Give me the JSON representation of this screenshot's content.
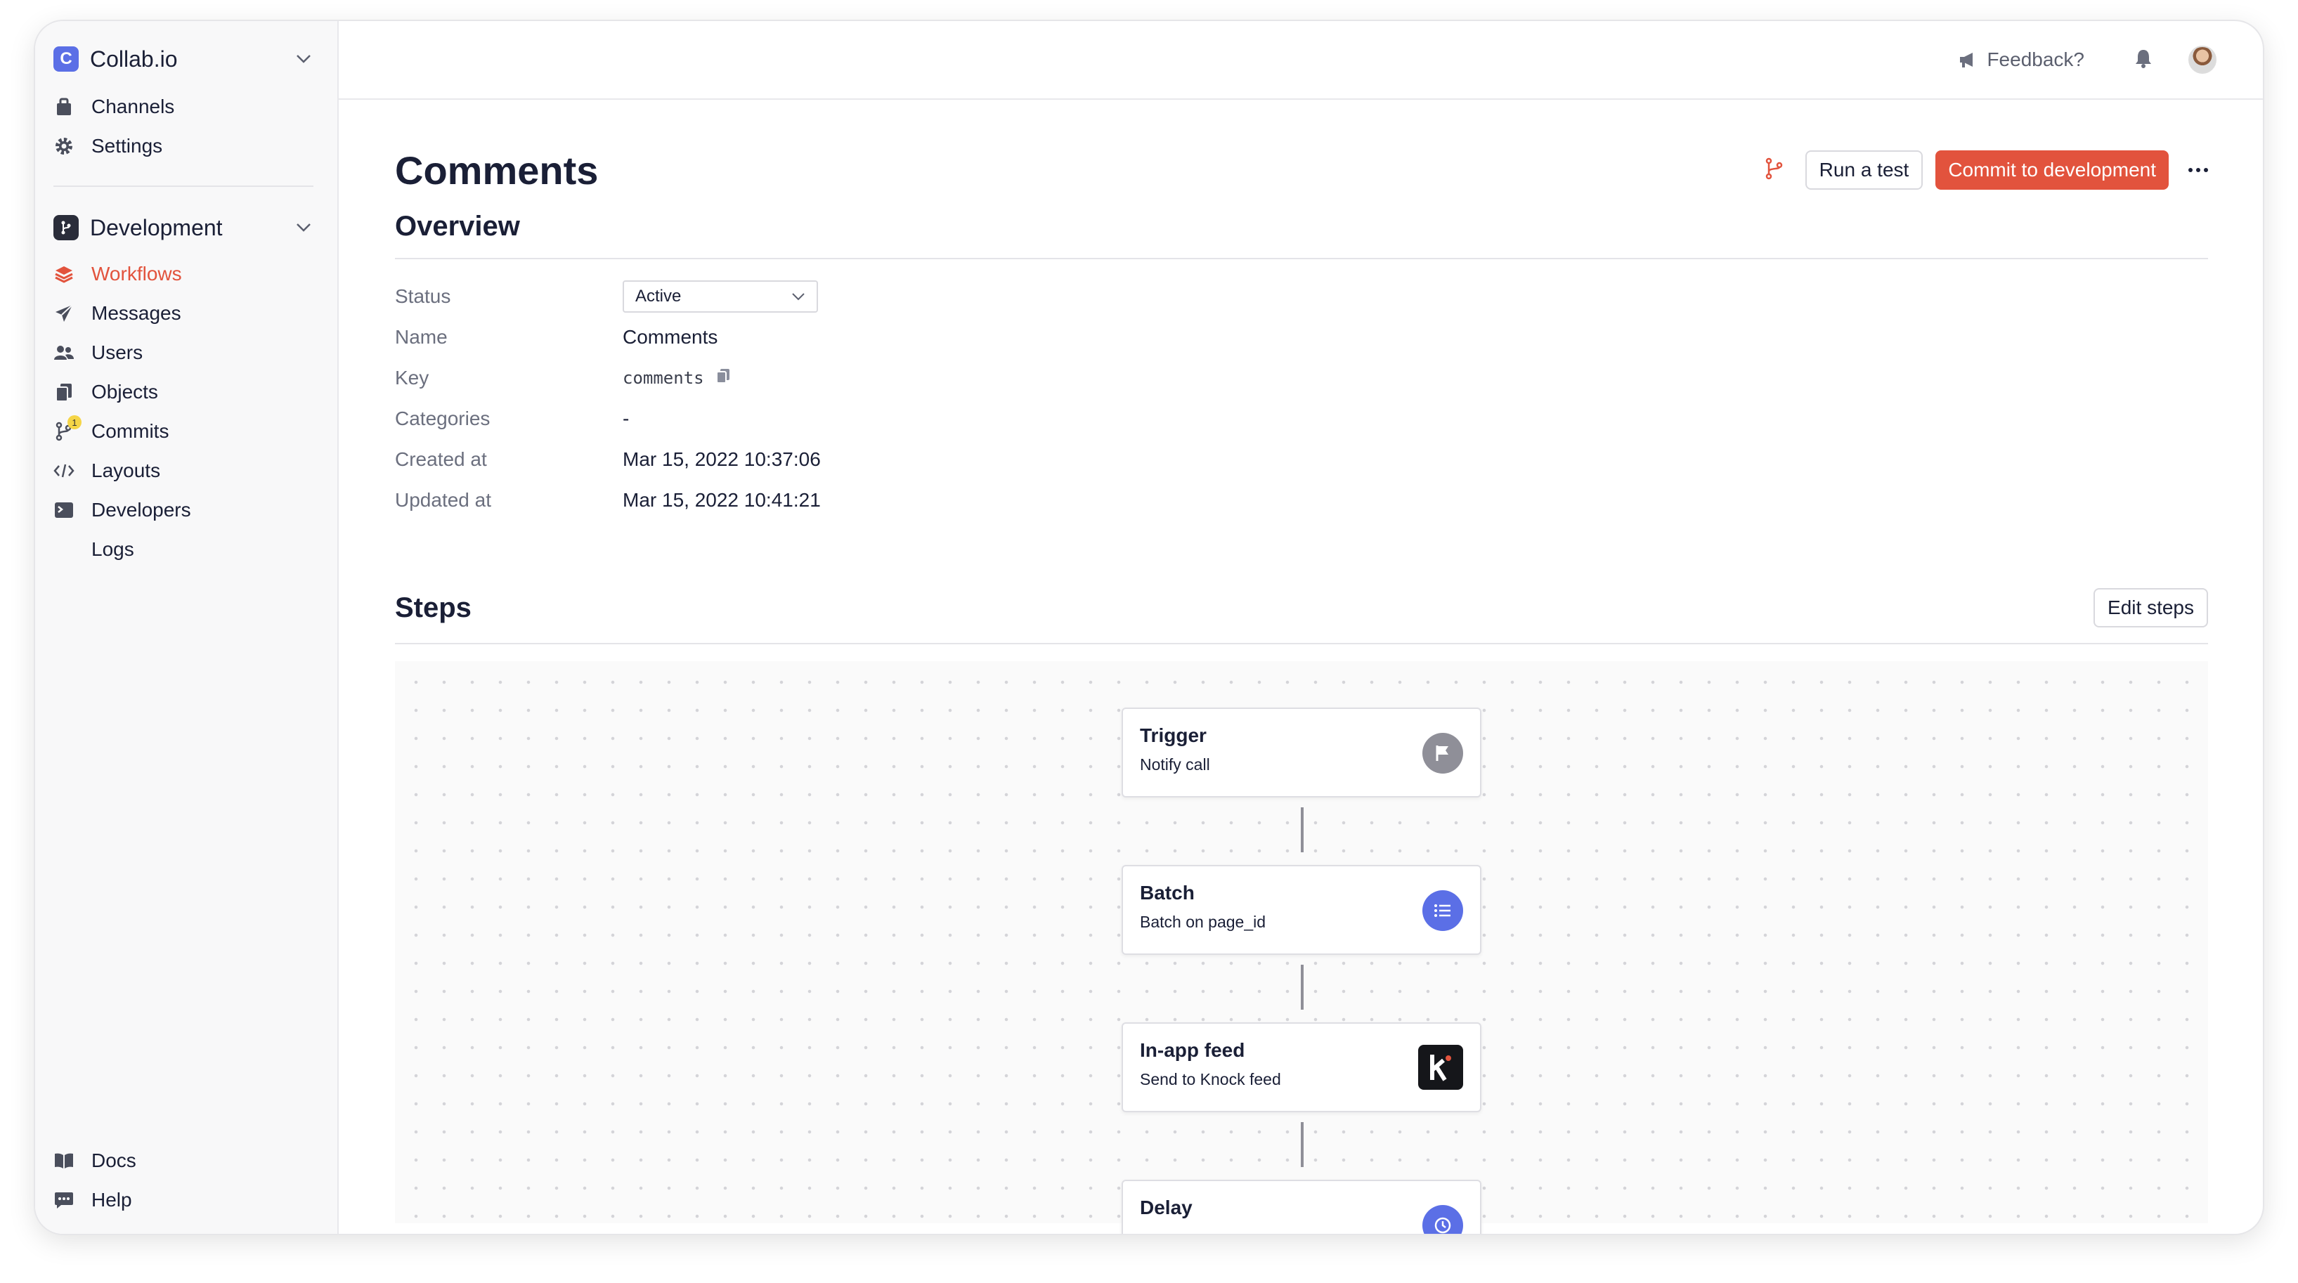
{
  "sidebar": {
    "org": {
      "logo_letter": "C",
      "name": "Collab.io"
    },
    "top_items": [
      {
        "label": "Channels",
        "icon": "channels-icon"
      },
      {
        "label": "Settings",
        "icon": "gear-icon"
      }
    ],
    "environment": {
      "name": "Development"
    },
    "env_items": [
      {
        "label": "Workflows",
        "icon": "layers-icon",
        "active": true
      },
      {
        "label": "Messages",
        "icon": "paper-plane-icon"
      },
      {
        "label": "Users",
        "icon": "users-icon"
      },
      {
        "label": "Objects",
        "icon": "objects-icon"
      },
      {
        "label": "Commits",
        "icon": "git-commit-icon",
        "badge": "1"
      },
      {
        "label": "Layouts",
        "icon": "code-icon"
      },
      {
        "label": "Developers",
        "icon": "terminal-icon"
      },
      {
        "label": "Logs",
        "icon": ""
      }
    ],
    "bottom_items": [
      {
        "label": "Docs",
        "icon": "book-icon"
      },
      {
        "label": "Help",
        "icon": "chat-icon"
      }
    ]
  },
  "topbar": {
    "feedback_label": "Feedback?"
  },
  "page": {
    "title": "Comments",
    "run_test_label": "Run a test",
    "commit_label": "Commit to development"
  },
  "overview": {
    "title": "Overview",
    "status_label": "Status",
    "status_value": "Active",
    "rows": [
      {
        "label": "Name",
        "value": "Comments"
      },
      {
        "label": "Key",
        "value": "comments"
      },
      {
        "label": "Categories",
        "value": "-"
      },
      {
        "label": "Created at",
        "value": "Mar 15, 2022 10:37:06"
      },
      {
        "label": "Updated at",
        "value": "Mar 15, 2022 10:41:21"
      }
    ]
  },
  "steps": {
    "title": "Steps",
    "edit_label": "Edit steps",
    "items": [
      {
        "title": "Trigger",
        "subtitle": "Notify call",
        "icon": "flag-icon"
      },
      {
        "title": "Batch",
        "subtitle": "Batch on page_id",
        "icon": "list-icon"
      },
      {
        "title": "In-app feed",
        "subtitle": "Send to Knock feed",
        "icon": "knock-logo-icon"
      },
      {
        "title": "Delay",
        "subtitle": "",
        "icon": "clock-icon"
      }
    ]
  },
  "colors": {
    "accent": "#e2533d",
    "brand": "#5b6fe6",
    "batch": "#5b6fe6"
  }
}
